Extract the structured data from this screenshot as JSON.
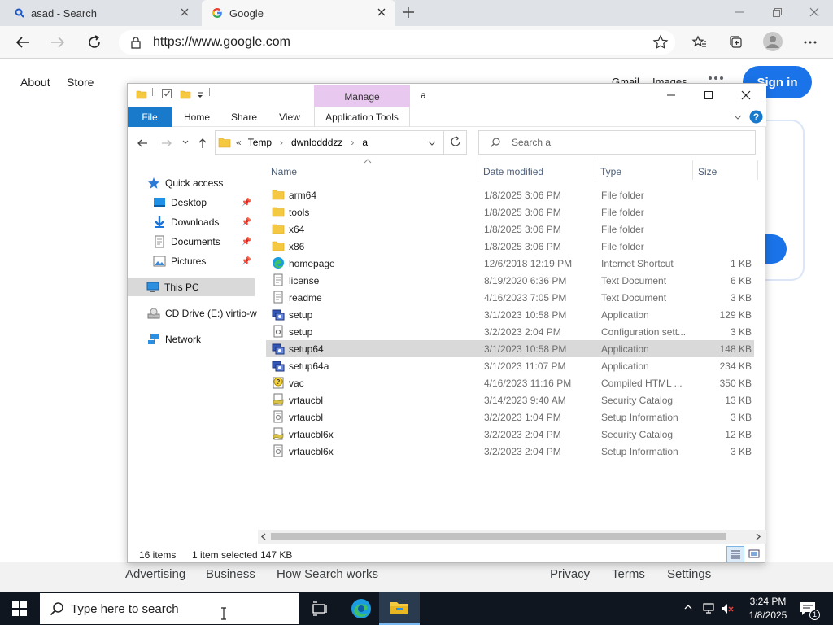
{
  "browser": {
    "tabs": [
      {
        "title": "asad - Search",
        "icon": "search-icon"
      },
      {
        "title": "Google",
        "icon": "google-g-icon"
      }
    ],
    "url": "https://www.google.com"
  },
  "google": {
    "top_left_links": [
      "About",
      "Store"
    ],
    "top_right_links": [
      "Gmail",
      "Images"
    ],
    "signin_label": "Sign in",
    "footer_links": [
      "Advertising",
      "Business",
      "How Search works",
      "Privacy",
      "Terms",
      "Settings"
    ]
  },
  "explorer": {
    "manage_label": "Manage",
    "window_title": "a",
    "ribbon_tabs": [
      "File",
      "Home",
      "Share",
      "View",
      "Application Tools"
    ],
    "address": {
      "prefix": "«",
      "parts": [
        "Temp",
        "dwnlodddzz",
        "a"
      ]
    },
    "search_placeholder": "Search a",
    "nav": {
      "quick_access": "Quick access",
      "desktop": "Desktop",
      "downloads": "Downloads",
      "documents": "Documents",
      "pictures": "Pictures",
      "this_pc": "This PC",
      "cd_drive": "CD Drive (E:) virtio-w",
      "network": "Network"
    },
    "columns": [
      "Name",
      "Date modified",
      "Type",
      "Size"
    ],
    "files": [
      {
        "name": "arm64",
        "date": "1/8/2025 3:06 PM",
        "type": "File folder",
        "size": "",
        "icon": "folder-icon"
      },
      {
        "name": "tools",
        "date": "1/8/2025 3:06 PM",
        "type": "File folder",
        "size": "",
        "icon": "folder-icon"
      },
      {
        "name": "x64",
        "date": "1/8/2025 3:06 PM",
        "type": "File folder",
        "size": "",
        "icon": "folder-icon"
      },
      {
        "name": "x86",
        "date": "1/8/2025 3:06 PM",
        "type": "File folder",
        "size": "",
        "icon": "folder-icon"
      },
      {
        "name": "homepage",
        "date": "12/6/2018 12:19 PM",
        "type": "Internet Shortcut",
        "size": "1 KB",
        "icon": "edge-shortcut-icon"
      },
      {
        "name": "license",
        "date": "8/19/2020 6:36 PM",
        "type": "Text Document",
        "size": "6 KB",
        "icon": "text-file-icon"
      },
      {
        "name": "readme",
        "date": "4/16/2023 7:05 PM",
        "type": "Text Document",
        "size": "3 KB",
        "icon": "text-file-icon"
      },
      {
        "name": "setup",
        "date": "3/1/2023 10:58 PM",
        "type": "Application",
        "size": "129 KB",
        "icon": "setup-app-icon"
      },
      {
        "name": "setup",
        "date": "3/2/2023 2:04 PM",
        "type": "Configuration sett...",
        "size": "3 KB",
        "icon": "config-file-icon"
      },
      {
        "name": "setup64",
        "date": "3/1/2023 10:58 PM",
        "type": "Application",
        "size": "148 KB",
        "icon": "setup-app-icon",
        "selected": true
      },
      {
        "name": "setup64a",
        "date": "3/1/2023 11:07 PM",
        "type": "Application",
        "size": "234 KB",
        "icon": "setup-app-icon"
      },
      {
        "name": "vac",
        "date": "4/16/2023 11:16 PM",
        "type": "Compiled HTML ...",
        "size": "350 KB",
        "icon": "help-file-icon"
      },
      {
        "name": "vrtaucbl",
        "date": "3/14/2023 9:40 AM",
        "type": "Security Catalog",
        "size": "13 KB",
        "icon": "catalog-file-icon"
      },
      {
        "name": "vrtaucbl",
        "date": "3/2/2023 1:04 PM",
        "type": "Setup Information",
        "size": "3 KB",
        "icon": "inf-file-icon"
      },
      {
        "name": "vrtaucbl6x",
        "date": "3/2/2023 2:04 PM",
        "type": "Security Catalog",
        "size": "12 KB",
        "icon": "catalog-file-icon"
      },
      {
        "name": "vrtaucbl6x",
        "date": "3/2/2023 2:04 PM",
        "type": "Setup Information",
        "size": "3 KB",
        "icon": "inf-file-icon"
      }
    ],
    "status": {
      "count": "16 items",
      "selected": "1 item selected",
      "size": "147 KB"
    }
  },
  "taskbar": {
    "search_placeholder": "Type here to search",
    "time": "3:24 PM",
    "date": "1/8/2025",
    "notification_count": "1"
  },
  "colors": {
    "accent": "#1979ca",
    "google_blue": "#1a73e8",
    "manage": "#e9c8f0",
    "taskbar": "#10161f"
  }
}
